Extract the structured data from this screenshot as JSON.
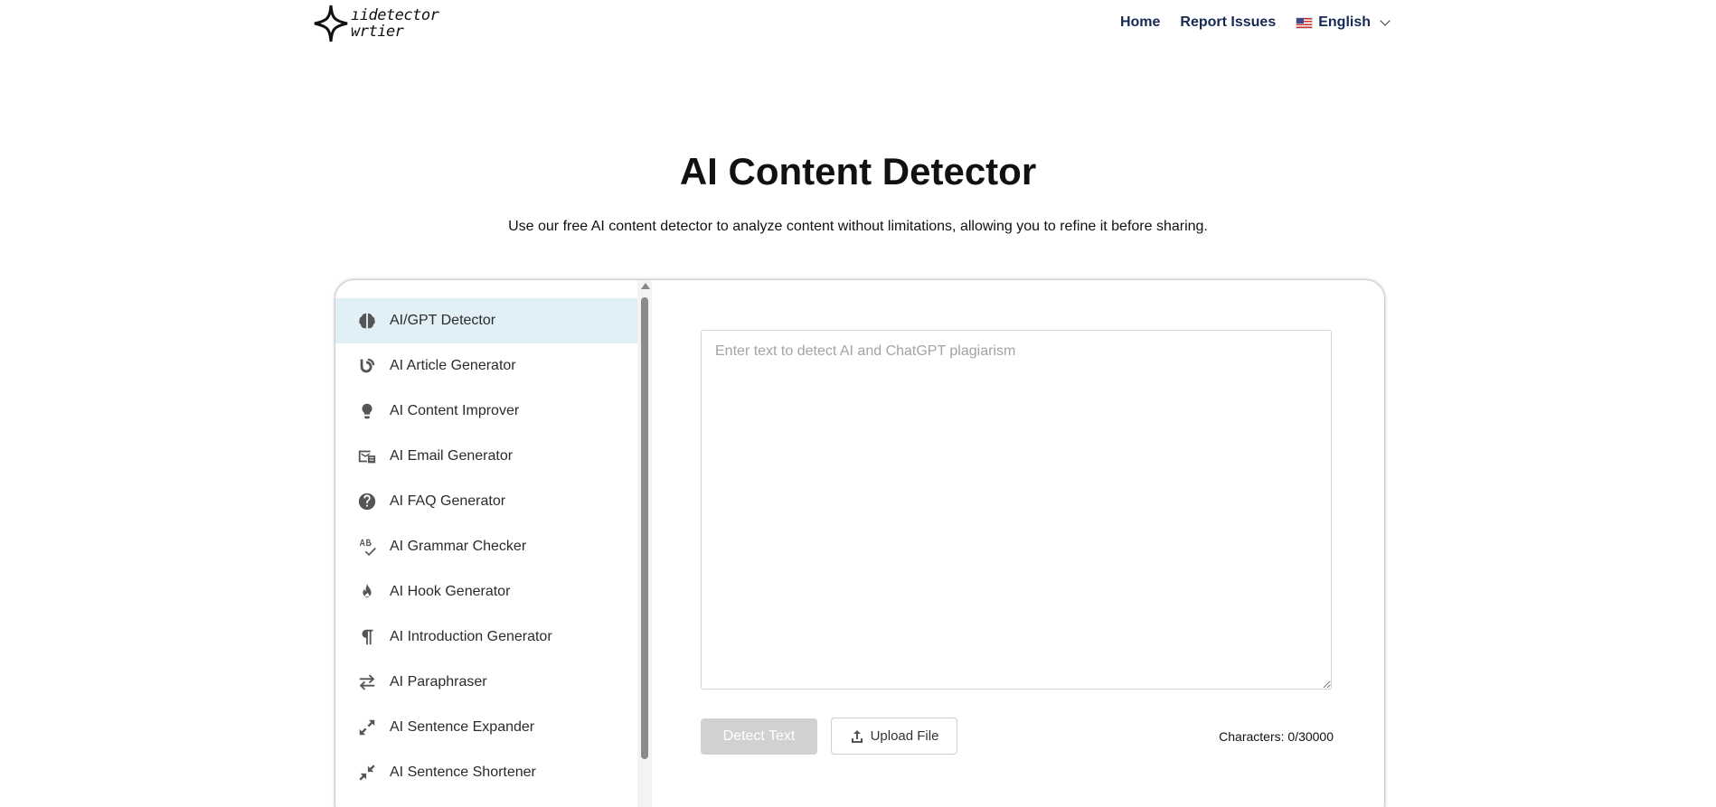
{
  "header": {
    "logo_line1": "ıidetector",
    "logo_line2": "wrtier",
    "nav": [
      {
        "label": "Home"
      },
      {
        "label": "Report Issues"
      }
    ],
    "language": "English"
  },
  "hero": {
    "title": "AI Content Detector",
    "subtitle": "Use our free AI content detector to analyze content without limitations, allowing you to refine it before sharing."
  },
  "sidebar": {
    "items": [
      {
        "label": "AI/GPT Detector",
        "icon": "brain-icon",
        "active": true
      },
      {
        "label": "AI Article Generator",
        "icon": "article-icon"
      },
      {
        "label": "AI Content Improver",
        "icon": "lightbulb-icon"
      },
      {
        "label": "AI Email Generator",
        "icon": "email-icon"
      },
      {
        "label": "AI FAQ Generator",
        "icon": "question-circle-icon"
      },
      {
        "label": "AI Grammar Checker",
        "icon": "spellcheck-icon"
      },
      {
        "label": "AI Hook Generator",
        "icon": "flame-icon"
      },
      {
        "label": "AI Introduction Generator",
        "icon": "paragraph-icon"
      },
      {
        "label": "AI Paraphraser",
        "icon": "swap-arrows-icon"
      },
      {
        "label": "AI Sentence Expander",
        "icon": "expand-icon"
      },
      {
        "label": "AI Sentence Shortener",
        "icon": "collapse-icon"
      }
    ]
  },
  "editor": {
    "placeholder": "Enter text to detect AI and ChatGPT plagiarism",
    "value": ""
  },
  "actions": {
    "detect_label": "Detect Text",
    "upload_label": "Upload File",
    "char_count": "Characters: 0/30000"
  }
}
